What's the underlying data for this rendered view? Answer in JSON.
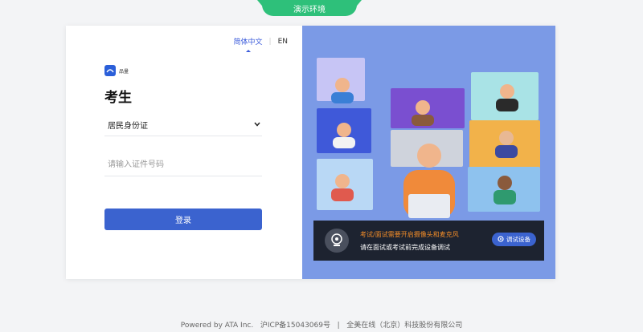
{
  "demo_tab": "演示环境",
  "lang": {
    "zh": "简体中文",
    "sep": "|",
    "en": "EN"
  },
  "brand": {
    "text": "品量"
  },
  "role_title": "考生",
  "id_type": {
    "selected": "居民身份证"
  },
  "id_input": {
    "placeholder": "请输入证件号码"
  },
  "login_button": "登录",
  "banner": {
    "warning": "考试/面试需要开启摄像头和麦克风",
    "note": "请在面试或考试前完成设备调试",
    "test_button": "调试设备"
  },
  "footer": {
    "powered": "Powered by ATA Inc.",
    "icp": "沪ICP备15043069号",
    "sep": "|",
    "company": "全美在线（北京）科技股份有限公司"
  },
  "colors": {
    "accent": "#3b63cf",
    "demo_green": "#2ec07a",
    "illustration_bg": "#7b9ae6",
    "warning": "#f28c28"
  }
}
